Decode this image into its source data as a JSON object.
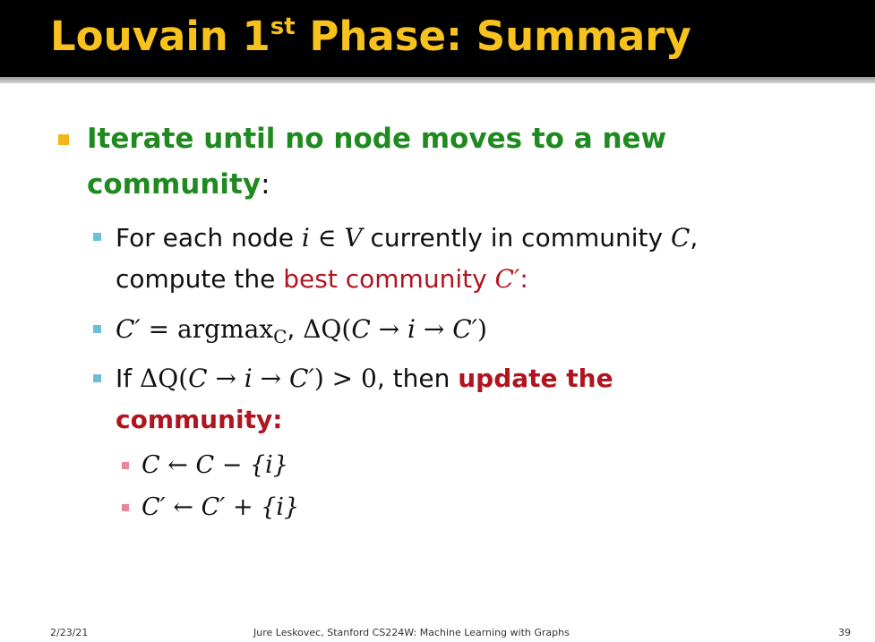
{
  "title": {
    "main": "Louvain 1",
    "sup": "st",
    "rest": " Phase: Summary"
  },
  "b1": {
    "line1": "Iterate until no node moves to a new",
    "line2_bold": "community",
    "line2_tail": ":"
  },
  "b2": {
    "pre": "For each node ",
    "i": "i",
    "in": " ∈ ",
    "V": "V",
    "mid": " currently in community ",
    "C": "C",
    "comma": ",",
    "line2_pre": "compute the ",
    "best": "best community ",
    "Cprime": "C′",
    "colon": ":"
  },
  "b3": {
    "lhs": "C′",
    "eq": " = argmax",
    "sub": "C",
    "comma": ",",
    "dq": " ΔQ(",
    "arg": "C → i → C′",
    "close": ")"
  },
  "b4": {
    "pre": "If ",
    "dq": "ΔQ(",
    "arg": "C → i → C′",
    "cond": ") > 0",
    "mid": ", then ",
    "upd": "update the",
    "line2": "community:"
  },
  "b5": {
    "expr": "C ← C − {i}"
  },
  "b6": {
    "expr": "C′ ← C′ + {i}"
  },
  "footer": {
    "date": "2/23/21",
    "center": "Jure Leskovec, Stanford CS224W: Machine Learning with Graphs",
    "page": "39"
  },
  "colors": {
    "title": "#f7c21d",
    "green": "#1f8a1f",
    "red": "#b0151f",
    "marker1": "#f4b41c",
    "marker2": "#6bc0d8",
    "marker3": "#e8879c"
  }
}
